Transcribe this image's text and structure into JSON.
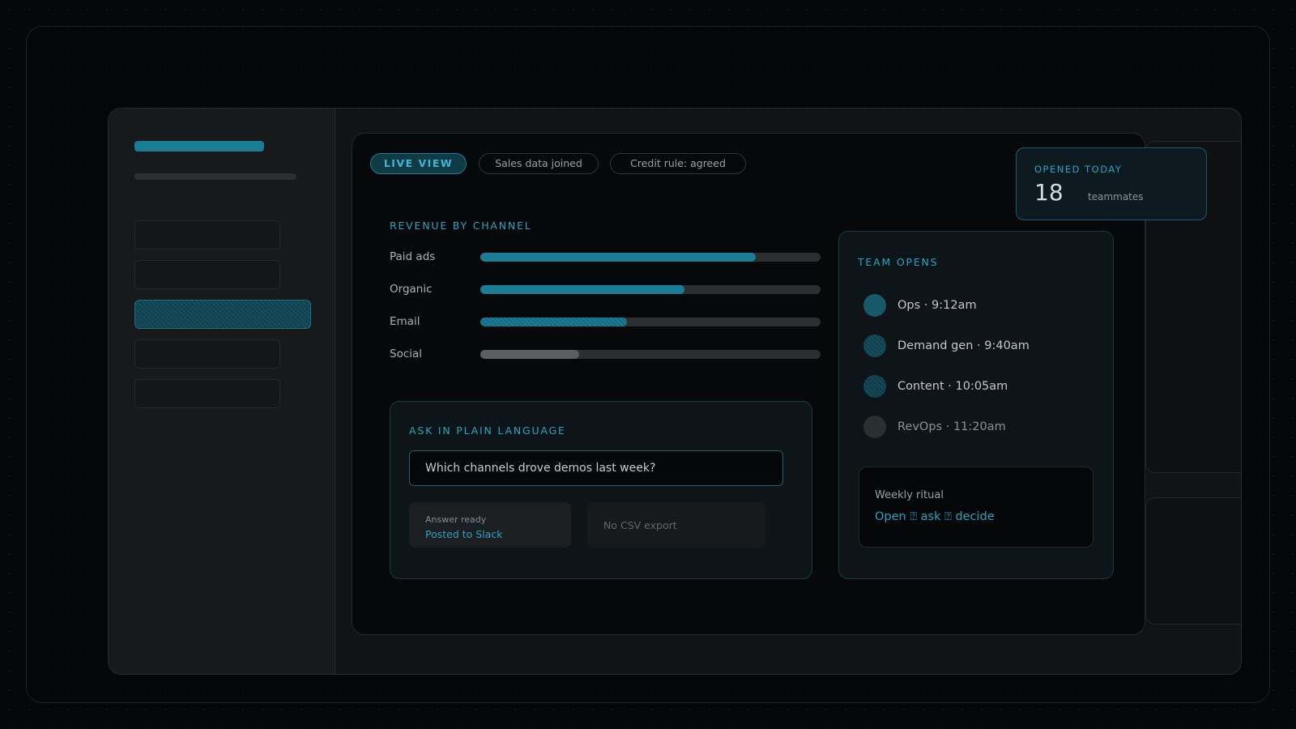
{
  "status_pills": {
    "live": "LIVE VIEW",
    "sales": "Sales data joined",
    "credit": "Credit rule: agreed"
  },
  "revenue": {
    "title": "REVENUE BY CHANNEL",
    "channels": [
      {
        "label": "Paid ads",
        "share": 0.81
      },
      {
        "label": "Organic",
        "share": 0.6
      },
      {
        "label": "Email",
        "share": 0.43
      },
      {
        "label": "Social",
        "share": 0.29
      }
    ]
  },
  "ask": {
    "title": "ASK IN PLAIN LANGUAGE",
    "query": "Which channels drove demos last week?",
    "answer_caption": "Answer ready",
    "answer_link": "Posted to Slack",
    "no_export": "No CSV export"
  },
  "team": {
    "title": "TEAM OPENS",
    "opens": [
      {
        "text": "Ops · 9:12am"
      },
      {
        "text": "Demand gen · 9:40am"
      },
      {
        "text": "Content · 10:05am"
      },
      {
        "text": "RevOps · 11:20am"
      }
    ],
    "ritual_label": "Weekly ritual",
    "ritual_value": "Open ⍰ ask ⍰ decide"
  },
  "opened_today": {
    "label": "OPENED TODAY",
    "count": "18",
    "unit": "teammates"
  },
  "colors": {
    "accent": "#1a7d96",
    "accent_text": "#2aa3c2",
    "background": "#050607"
  }
}
